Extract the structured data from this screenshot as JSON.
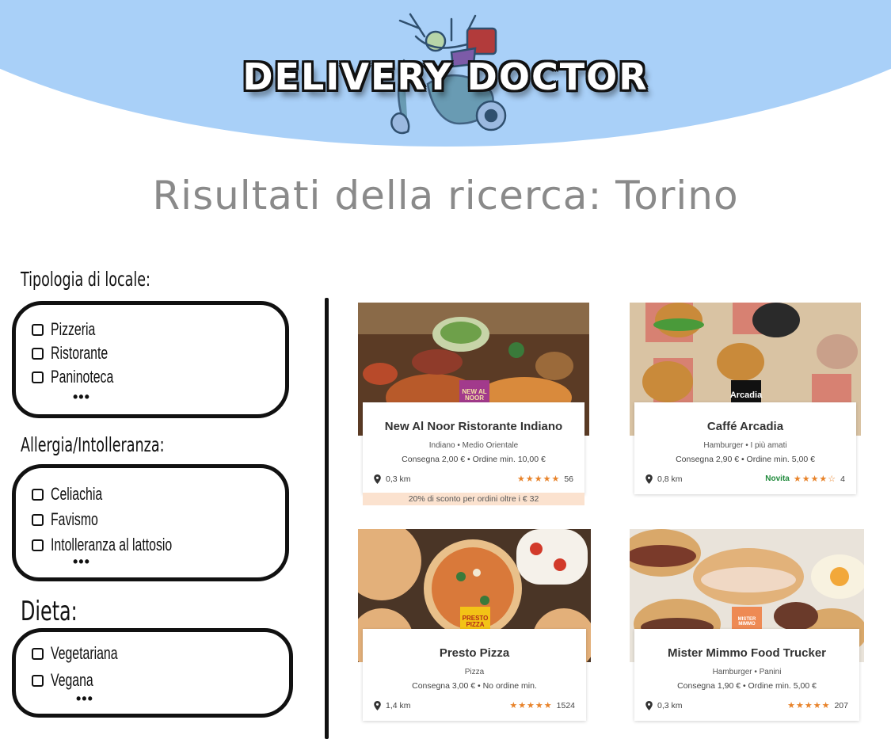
{
  "header": {
    "logo_text": "DELIVERY DOCTOR",
    "bg_color": "#a9d0f8"
  },
  "page_title": "Risultati della ricerca: Torino",
  "filters": [
    {
      "title": "Tipologia di locale:",
      "options": [
        "Pizzeria",
        "Ristorante",
        "Paninoteca"
      ],
      "more": "•••"
    },
    {
      "title": "Allergia/Intolleranza:",
      "options": [
        "Celiachia",
        "Favismo",
        "Intolleranza al lattosio"
      ],
      "more": "•••"
    },
    {
      "title": "Dieta:",
      "options": [
        "Vegetariana",
        "Vegana"
      ],
      "more": "•••"
    }
  ],
  "restaurants": [
    {
      "name": "New Al Noor Ristorante Indiano",
      "categories": "Indiano • Medio Orientale",
      "fees": "Consegna 2,00 € • Ordine min. 10,00 €",
      "distance": "0,3 km",
      "rating": 4.5,
      "stars": "★★★★★",
      "review_count": "56",
      "promo": "20% di sconto per ordini oltre i € 32",
      "badge_text": "NEW AL NOOR",
      "badge_color": "#a23a8c"
    },
    {
      "name": "Caffé Arcadia",
      "categories": "Hamburger • I più amati",
      "fees": "Consegna 2,90 € • Ordine min. 5,00 €",
      "distance": "0,8 km",
      "novita": "Novita",
      "rating": 4,
      "stars": "★★★★☆",
      "review_count": "4",
      "badge_text": "Arcadia",
      "badge_color": "#111111"
    },
    {
      "name": "Presto Pizza",
      "categories": "Pizza",
      "fees": "Consegna 3,00 € • No ordine min.",
      "distance": "1,4 km",
      "rating": 4.5,
      "stars": "★★★★★",
      "review_count": "1524",
      "badge_text": "PRESTO PIZZA",
      "badge_color": "#f3c316"
    },
    {
      "name": "Mister Mimmo Food Trucker",
      "categories": "Hamburger • Panini",
      "fees": "Consegna 1,90 € • Ordine min. 5,00 €",
      "distance": "0,3 km",
      "rating": 4.5,
      "stars": "★★★★★",
      "review_count": "207",
      "badge_text": "MISTER MIMMO",
      "badge_color": "#ee8a54"
    }
  ]
}
